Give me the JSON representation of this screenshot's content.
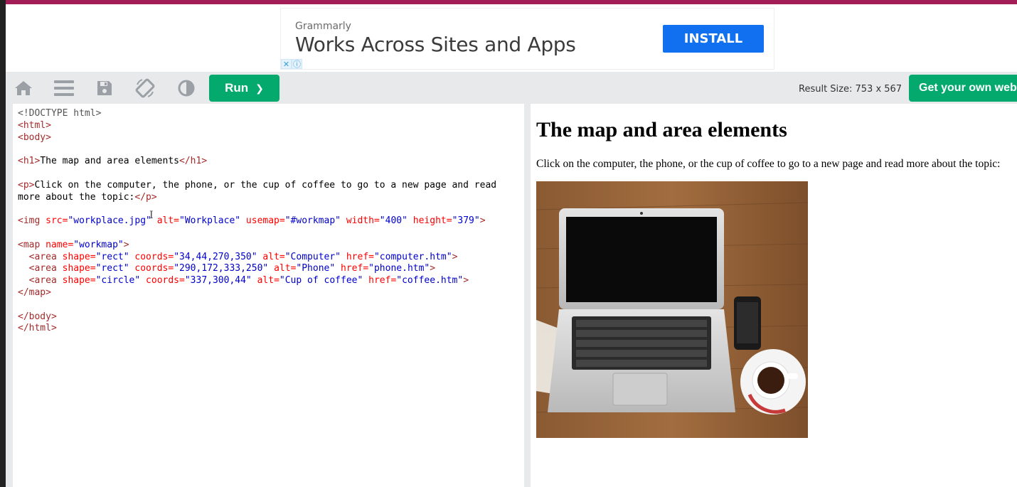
{
  "ad": {
    "brand": "Grammarly",
    "headline": "Works Across Sites and Apps",
    "cta": "INSTALL",
    "close_glyph": "✕",
    "info_glyph": "ⓘ"
  },
  "toolbar": {
    "icons": [
      "home-icon",
      "menu-icon",
      "save-icon",
      "rotate-icon",
      "contrast-icon"
    ],
    "run_label": "Run",
    "run_chevron": "❯",
    "result_size": "Result Size: 753 x 567",
    "get_site_label": "Get your own websi"
  },
  "editor": {
    "lines": [
      "<!DOCTYPE html>",
      "<html>",
      "<body>",
      "",
      "<h1>The map and area elements</h1>",
      "",
      "<p>Click on the computer, the phone, or the cup of coffee to go to a new page and read",
      "more about the topic:</p>",
      "",
      "<img src=\"workplace.jpg\" alt=\"Workplace\" usemap=\"#workmap\" width=\"400\" height=\"379\">",
      "",
      "<map name=\"workmap\">",
      "  <area shape=\"rect\" coords=\"34,44,270,350\" alt=\"Computer\" href=\"computer.htm\">",
      "  <area shape=\"rect\" coords=\"290,172,333,250\" alt=\"Phone\" href=\"phone.htm\">",
      "  <area shape=\"circle\" coords=\"337,300,44\" alt=\"Cup of coffee\" href=\"coffee.htm\">",
      "</map>",
      "",
      "</body>",
      "</html>"
    ]
  },
  "result": {
    "heading": "The map and area elements",
    "paragraph": "Click on the computer, the phone, or the cup of coffee to go to a new page and read more about the topic:",
    "image_alt": "Workplace"
  },
  "colors": {
    "accent_green": "#04aa6d",
    "ad_blue": "#1170f0",
    "top_strip": "#a31d57",
    "code_tag": "#a52a2a",
    "code_attr": "#ff0000",
    "code_value": "#0000cd"
  }
}
